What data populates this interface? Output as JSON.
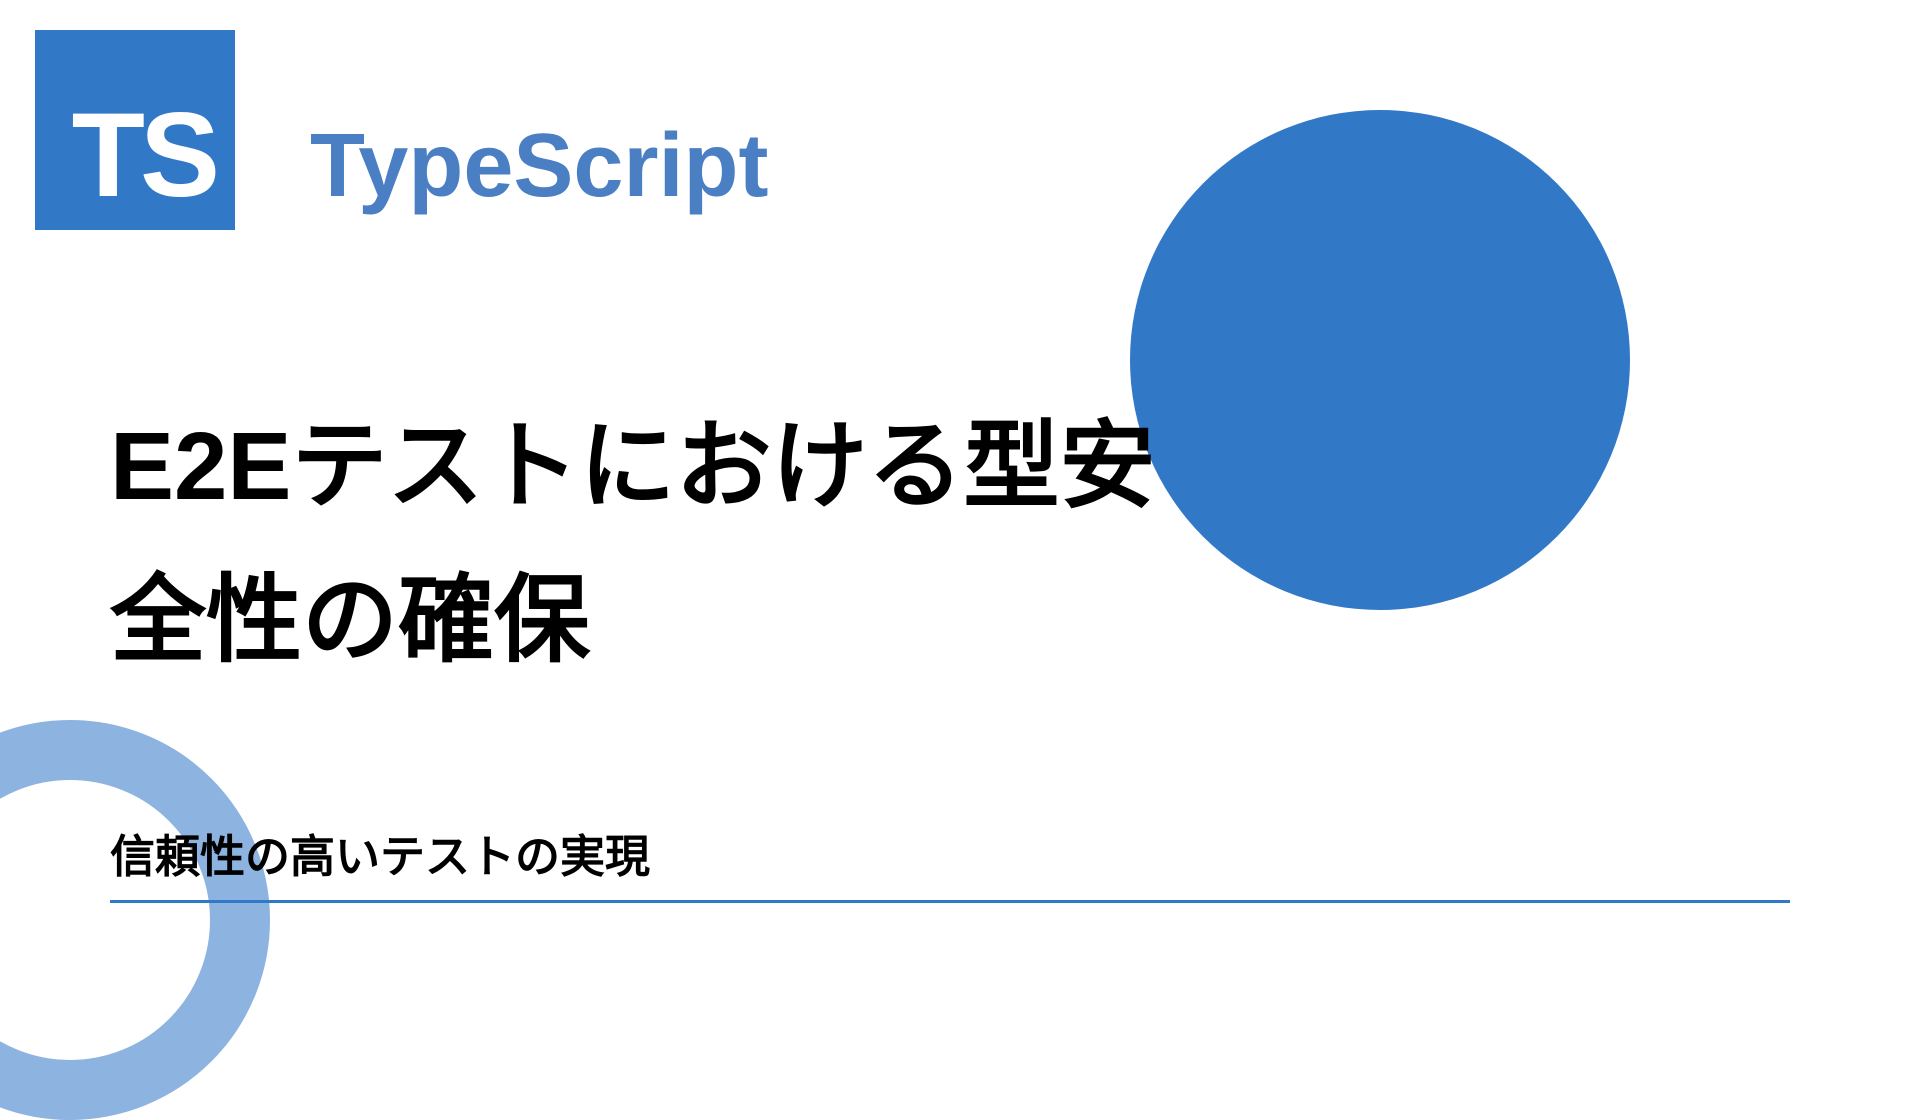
{
  "logo": {
    "text": "TS"
  },
  "brand": "TypeScript",
  "title": "E2Eテストにおける型安全性の確保",
  "subtitle": "信頼性の高いテストの実現"
}
